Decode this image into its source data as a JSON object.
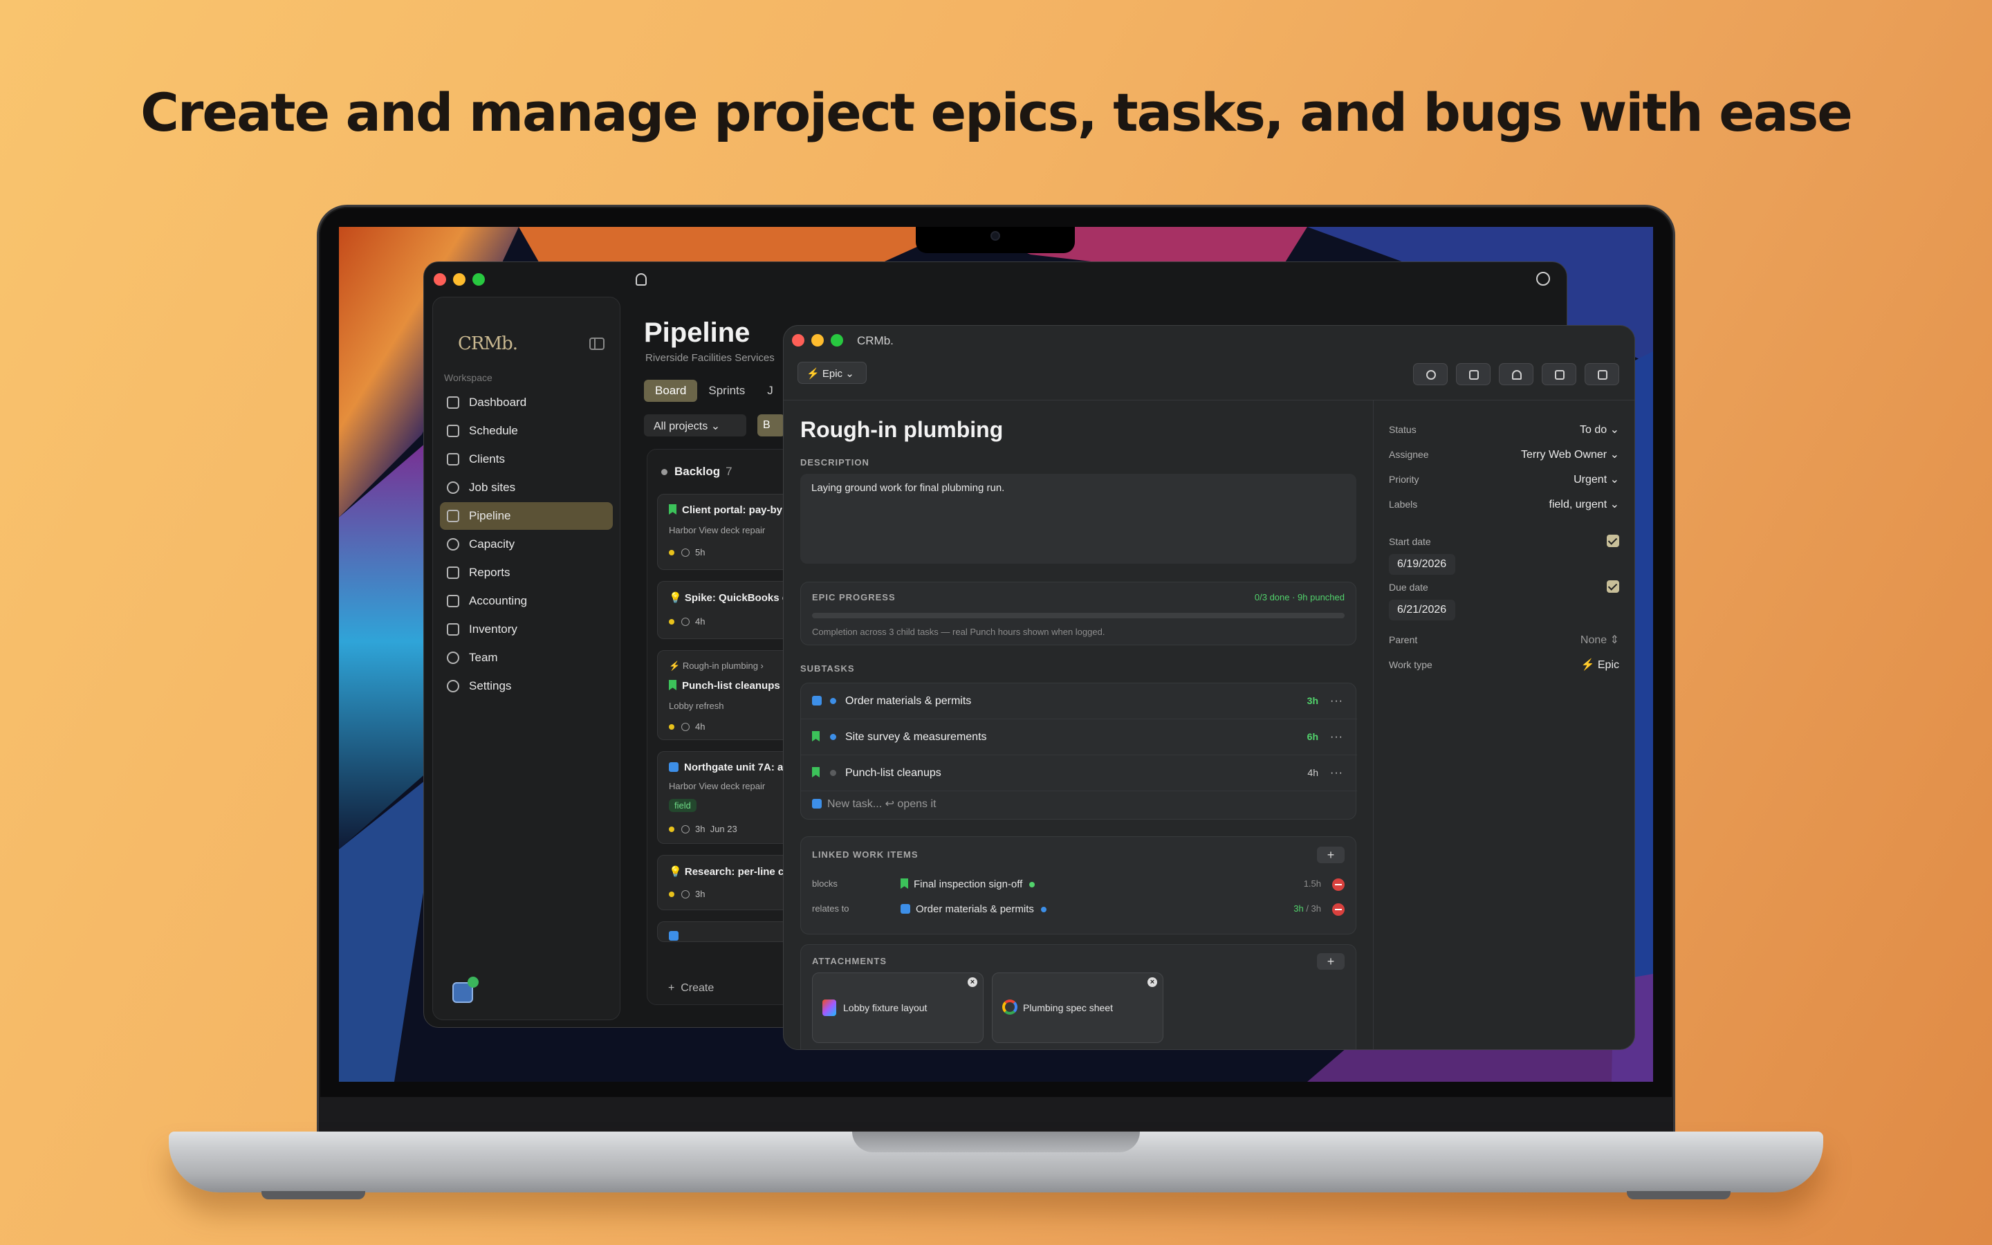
{
  "headline": "Create and manage project epics, tasks, and bugs with ease",
  "app": {
    "logo": "CRMb.",
    "workspace_label": "Workspace",
    "nav": [
      {
        "label": "Dashboard",
        "icon": "grid-icon"
      },
      {
        "label": "Schedule",
        "icon": "calendar-icon"
      },
      {
        "label": "Clients",
        "icon": "contact-icon"
      },
      {
        "label": "Job sites",
        "icon": "anchor-icon"
      },
      {
        "label": "Pipeline",
        "icon": "briefcase-icon",
        "active": true
      },
      {
        "label": "Capacity",
        "icon": "gauge-icon"
      },
      {
        "label": "Reports",
        "icon": "document-icon"
      },
      {
        "label": "Accounting",
        "icon": "bank-icon"
      },
      {
        "label": "Inventory",
        "icon": "box-icon"
      },
      {
        "label": "Team",
        "icon": "people-icon"
      },
      {
        "label": "Settings",
        "icon": "gear-icon"
      }
    ]
  },
  "pipeline": {
    "title": "Pipeline",
    "subtitle": "Riverside Facilities Services",
    "tabs": [
      "Board",
      "Sprints",
      "J"
    ],
    "filter": "All projects",
    "filter_btn2": "B",
    "column": {
      "name": "Backlog",
      "count": "7"
    },
    "cards": [
      {
        "title": "Client portal: pay-by",
        "sub": "Harbor View deck repair",
        "hours": "5h"
      },
      {
        "title": "Spike: QuickBooks e",
        "hours": "4h"
      },
      {
        "parent": "Rough-in plumbing",
        "title": "Punch-list cleanups",
        "sub": "Lobby refresh",
        "hours": "4h"
      },
      {
        "title": "Northgate unit 7A: a",
        "sub": "Harbor View deck repair",
        "tag": "field",
        "hours": "3h",
        "date": "Jun 23"
      },
      {
        "title": "Research: per-line c",
        "hours": "3h"
      }
    ],
    "create_label": "Create"
  },
  "detail": {
    "window_title": "CRMb.",
    "type_pill": "Epic",
    "title": "Rough-in plumbing",
    "description_label": "DESCRIPTION",
    "description": "Laying ground work for final plubming run.",
    "progress": {
      "label": "EPIC PROGRESS",
      "status": "0/3 done · 9h punched",
      "note": "Completion across 3 child tasks — real Punch hours shown when logged.",
      "fraction": 0
    },
    "subtasks_label": "SUBTASKS",
    "subtasks": [
      {
        "name": "Order materials & permits",
        "hours": "3h"
      },
      {
        "name": "Site survey & measurements",
        "hours": "6h"
      },
      {
        "name": "Punch-list cleanups",
        "hours": "4h"
      }
    ],
    "new_task_placeholder": "New task... ↩ opens it",
    "linked_label": "LINKED WORK ITEMS",
    "linked": [
      {
        "relation": "blocks",
        "name": "Final inspection sign-off",
        "hours": "1.5h"
      },
      {
        "relation": "relates to",
        "name": "Order materials & permits",
        "hours_done": "3h",
        "hours_total": " / 3h"
      }
    ],
    "attachments_label": "ATTACHMENTS",
    "attachments": [
      "Lobby fixture layout",
      "Plumbing spec sheet"
    ],
    "fields": {
      "status_label": "Status",
      "status": "To do",
      "assignee_label": "Assignee",
      "assignee": "Terry Web Owner",
      "priority_label": "Priority",
      "priority": "Urgent",
      "labels_label": "Labels",
      "labels": "field, urgent",
      "start_label": "Start date",
      "start": "6/19/2026",
      "due_label": "Due date",
      "due": "6/21/2026",
      "parent_label": "Parent",
      "parent": "None",
      "worktype_label": "Work type",
      "worktype": "Epic"
    }
  }
}
